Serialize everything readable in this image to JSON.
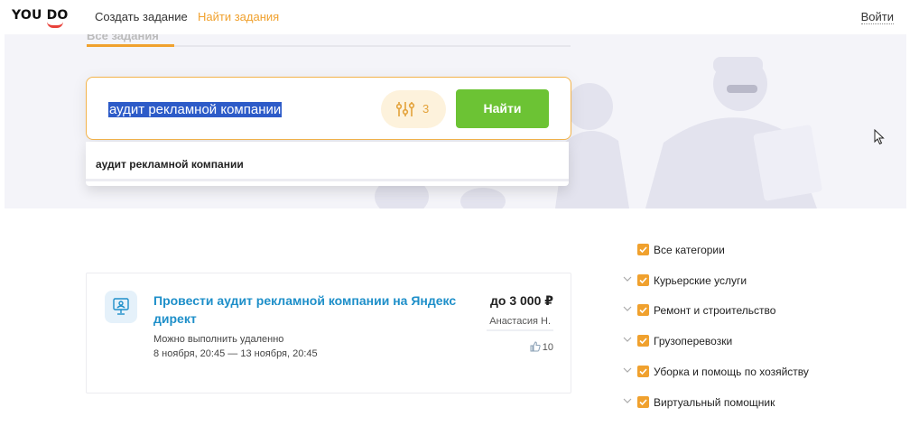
{
  "header": {
    "logo": "YOU DO",
    "nav": [
      "Создать задание",
      "Найти задания"
    ],
    "login": "Войти"
  },
  "hero": {
    "tab_label": "Все задания"
  },
  "search": {
    "query": "аудит рекламной компании",
    "filter_count": "3",
    "find_label": "Найти",
    "suggestion": "аудит рекламной компании"
  },
  "task": {
    "title": "Провести аудит рекламной компании на Яндекс директ",
    "remote": "Можно выполнить удаленно",
    "dates": "8 ноября, 20:45 — 13 ноября, 20:45",
    "price": "до 3 000 ₽",
    "author": "Анастасия Н.",
    "likes": "10"
  },
  "categories": [
    {
      "label": "Все категории",
      "checked": true,
      "expandable": false
    },
    {
      "label": "Курьерские услуги",
      "checked": true,
      "expandable": true
    },
    {
      "label": "Ремонт и строительство",
      "checked": true,
      "expandable": true
    },
    {
      "label": "Грузоперевозки",
      "checked": true,
      "expandable": true
    },
    {
      "label": "Уборка и помощь по хозяйству",
      "checked": true,
      "expandable": true
    },
    {
      "label": "Виртуальный помощник",
      "checked": true,
      "expandable": true
    }
  ],
  "colors": {
    "accent": "#f0a12e",
    "find_button": "#6cc334",
    "link": "#1e8fc9",
    "selection": "#2d5bc8"
  }
}
